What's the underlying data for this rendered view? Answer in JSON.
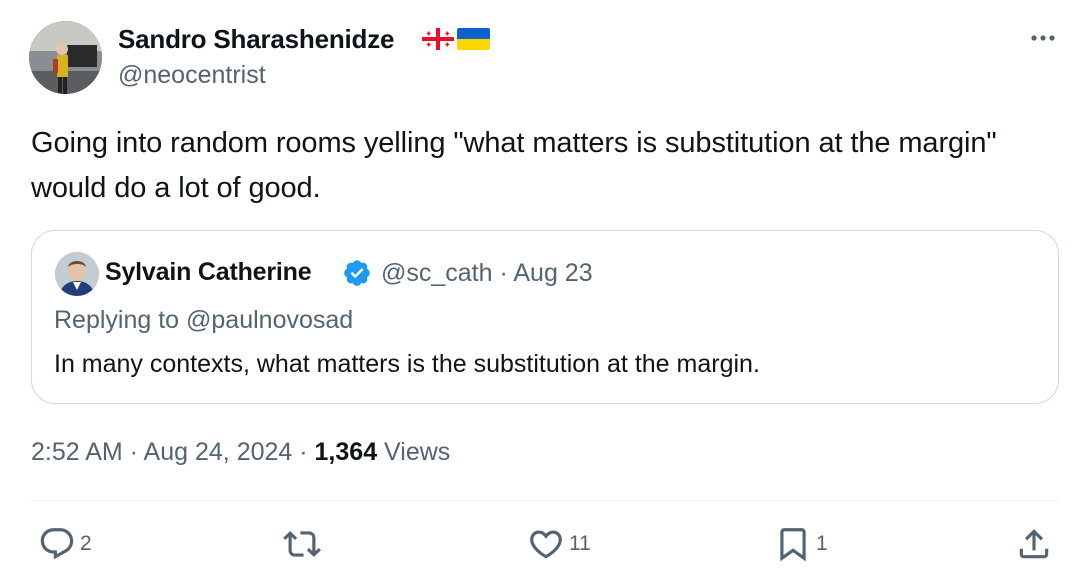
{
  "author": {
    "name": "Sandro Sharashenidze",
    "handle": "@neocentrist",
    "flags": [
      "georgia-flag-icon",
      "ukraine-flag-icon"
    ]
  },
  "tweet": {
    "text": "Going into random rooms yelling \"what matters is substitution at the margin\" would do a lot of good."
  },
  "quote": {
    "name": "Sylvain Catherine",
    "verified": true,
    "meta": "@sc_cath · Aug 23",
    "replying": "Replying to @paulnovosad",
    "text": "In many contexts, what matters is the substitution at the margin."
  },
  "timestamp": {
    "time_date": "2:52 AM · Aug 24, 2024 · ",
    "views_count": "1,364",
    "views_label": " Views"
  },
  "actions": {
    "reply_count": "2",
    "repost_count": "",
    "like_count": "11",
    "bookmark_count": "1"
  },
  "colors": {
    "text": "#0f1419",
    "secondary": "#536471",
    "border": "#cfd9de",
    "verified": "#1d9bf0"
  }
}
